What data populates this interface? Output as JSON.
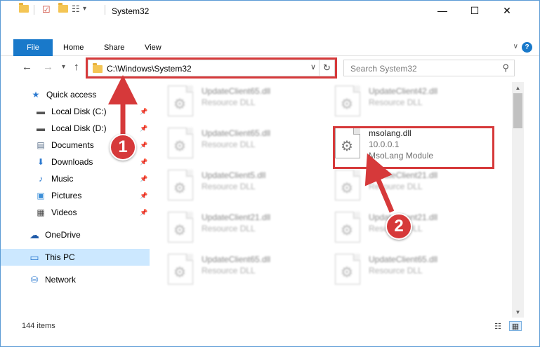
{
  "window": {
    "title": "System32"
  },
  "quick_access_toolbar": {
    "dropdown_glyph": "▾"
  },
  "window_controls": {
    "minimize": "—",
    "maximize": "☐",
    "close": "✕"
  },
  "ribbon": {
    "tabs": [
      {
        "label": "File"
      },
      {
        "label": "Home"
      },
      {
        "label": "Share"
      },
      {
        "label": "View"
      }
    ],
    "help_label": "?"
  },
  "navigation": {
    "back": "←",
    "forward": "→",
    "recent": "▾",
    "up": "↑",
    "address": "C:\\Windows\\System32",
    "address_dropdown": "∨",
    "refresh": "↻",
    "search_placeholder": "Search System32",
    "search_icon": "⚲"
  },
  "sidebar": {
    "items": [
      {
        "label": "Quick access",
        "icon": "star-icon",
        "glyph": "★",
        "color": "#2b79d0",
        "pinned": false
      },
      {
        "label": "Local Disk (C:)",
        "icon": "drive-icon",
        "glyph": "▬",
        "color": "#555555",
        "pinned": true
      },
      {
        "label": "Local Disk (D:)",
        "icon": "drive-icon",
        "glyph": "▬",
        "color": "#555555",
        "pinned": true
      },
      {
        "label": "Documents",
        "icon": "documents-icon",
        "glyph": "▤",
        "color": "#5a6f8a",
        "pinned": true
      },
      {
        "label": "Downloads",
        "icon": "downloads-icon",
        "glyph": "⬇",
        "color": "#2b79d0",
        "pinned": true
      },
      {
        "label": "Music",
        "icon": "music-icon",
        "glyph": "♪",
        "color": "#2b79d0",
        "pinned": true
      },
      {
        "label": "Pictures",
        "icon": "pictures-icon",
        "glyph": "▣",
        "color": "#3c8fd8",
        "pinned": true
      },
      {
        "label": "Videos",
        "icon": "videos-icon",
        "glyph": "▦",
        "color": "#444444",
        "pinned": true
      },
      {
        "label": "OneDrive",
        "icon": "onedrive-icon",
        "glyph": "☁",
        "color": "#1f5aa8",
        "pinned": false
      },
      {
        "label": "This PC",
        "icon": "computer-icon",
        "glyph": "▭",
        "color": "#2b79d0",
        "pinned": false,
        "selected": true
      },
      {
        "label": "Network",
        "icon": "network-icon",
        "glyph": "⛁",
        "color": "#2b79d0",
        "pinned": false
      }
    ],
    "pin_glyph": "📌"
  },
  "files": [
    {
      "name": "UpdateClient65.dll",
      "desc": "Resource DLL",
      "blurred": true
    },
    {
      "name": "UpdateClient42.dll",
      "desc": "Resource DLL",
      "blurred": true
    },
    {
      "name": "UpdateClient65.dll",
      "desc": "Resource DLL",
      "blurred": true
    },
    {
      "name": "msolang.dll",
      "desc": "10.0.0.1",
      "desc2": "MsoLang Module",
      "blurred": false
    },
    {
      "name": "UpdateClient5.dll",
      "desc": "Resource DLL",
      "blurred": true
    },
    {
      "name": "UpdateClient21.dll",
      "desc": "Resource DLL",
      "blurred": true
    },
    {
      "name": "UpdateClient21.dll",
      "desc": "Resource DLL",
      "blurred": true
    },
    {
      "name": "UpdateClient21.dll",
      "desc": "Resource DLL",
      "blurred": true
    },
    {
      "name": "UpdateClient65.dll",
      "desc": "Resource DLL",
      "blurred": true
    },
    {
      "name": "UpdateClient65.dll",
      "desc": "Resource DLL",
      "blurred": true
    }
  ],
  "scrollbar": {
    "up": "▲",
    "down": "▼"
  },
  "status": {
    "item_count": "144 items",
    "details_view": "☷",
    "tiles_view": "▦"
  },
  "annotations": {
    "step1": "1",
    "step2": "2",
    "color": "#d6393a"
  }
}
